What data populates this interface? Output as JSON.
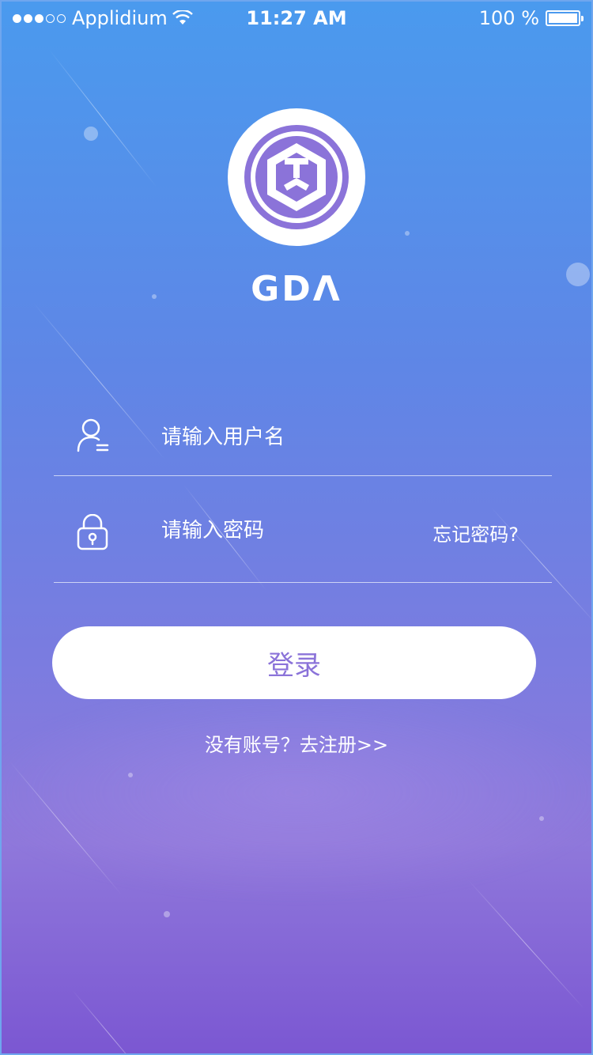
{
  "status_bar": {
    "carrier": "Applidium",
    "time": "11:27 AM",
    "battery": "100 %",
    "signal_bars_on": 3,
    "signal_bars_total": 5,
    "icons": [
      "wifi-icon",
      "battery-icon"
    ]
  },
  "logo": {
    "brand_name": "GDΛ",
    "accent_color": "#8b73d9"
  },
  "form": {
    "username_placeholder": "请输入用户名",
    "password_placeholder": "请输入密码",
    "forgot_label": "忘记密码?",
    "icons": [
      "user-icon",
      "lock-icon"
    ]
  },
  "actions": {
    "login_label": "登录",
    "register_link": "没有账号？去注册>>"
  },
  "colors": {
    "background_top": "#4a9aee",
    "background_bottom": "#7b57d2",
    "button_text": "#8b73d9"
  }
}
